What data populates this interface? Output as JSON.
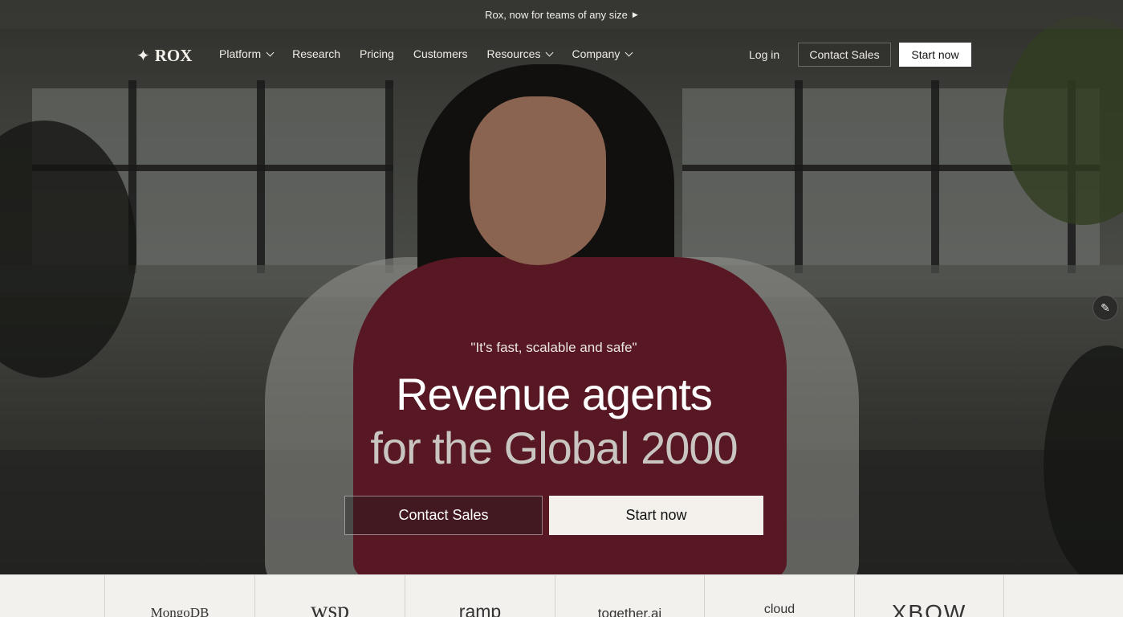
{
  "announcement": {
    "text": "Rox, now for teams of any size",
    "arrow_icon": "play-triangle"
  },
  "brand": {
    "name": "ROX",
    "icon": "sparkle-star"
  },
  "nav": {
    "items": [
      {
        "label": "Platform",
        "has_dropdown": true
      },
      {
        "label": "Research",
        "has_dropdown": false
      },
      {
        "label": "Pricing",
        "has_dropdown": false
      },
      {
        "label": "Customers",
        "has_dropdown": false
      },
      {
        "label": "Resources",
        "has_dropdown": true
      },
      {
        "label": "Company",
        "has_dropdown": true
      }
    ],
    "login": "Log in",
    "contact_sales": "Contact Sales",
    "start_now": "Start now"
  },
  "hero": {
    "quote": "\"It's fast, scalable and safe\"",
    "headline": "Revenue agents",
    "subheadline": "for the Global 2000",
    "contact_sales": "Contact Sales",
    "start_now": "Start now",
    "edit_icon": "pencil"
  },
  "logos": [
    "MongoDB",
    "wsp",
    "ramp",
    "together.ai",
    "cloud",
    "XBOW"
  ],
  "colors": {
    "primary_button_bg": "#f4f1ec",
    "headline": "#ffffff",
    "subheadline": "#c9c6c1",
    "logo_strip_bg": "#f3f1ee"
  }
}
